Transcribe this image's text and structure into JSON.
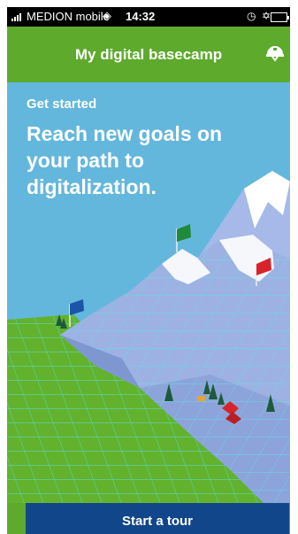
{
  "status_bar": {
    "carrier": "MEDION mobile",
    "time": "14:32"
  },
  "header": {
    "title": "My digital basecamp",
    "icon": "helmet-icon"
  },
  "hero": {
    "eyebrow": "Get started",
    "headline": "Reach new goals on\nyour path to\ndigitalization."
  },
  "footer": {
    "button_label": "Start a tour"
  },
  "colors": {
    "header_green": "#5daa2c",
    "sky_blue": "#64b7dc",
    "button_blue": "#12468a",
    "grid_line": "#5de0e6",
    "flag_green": "#1f8a3a",
    "flag_red": "#d8232a",
    "flag_blue": "#1c55a8"
  }
}
